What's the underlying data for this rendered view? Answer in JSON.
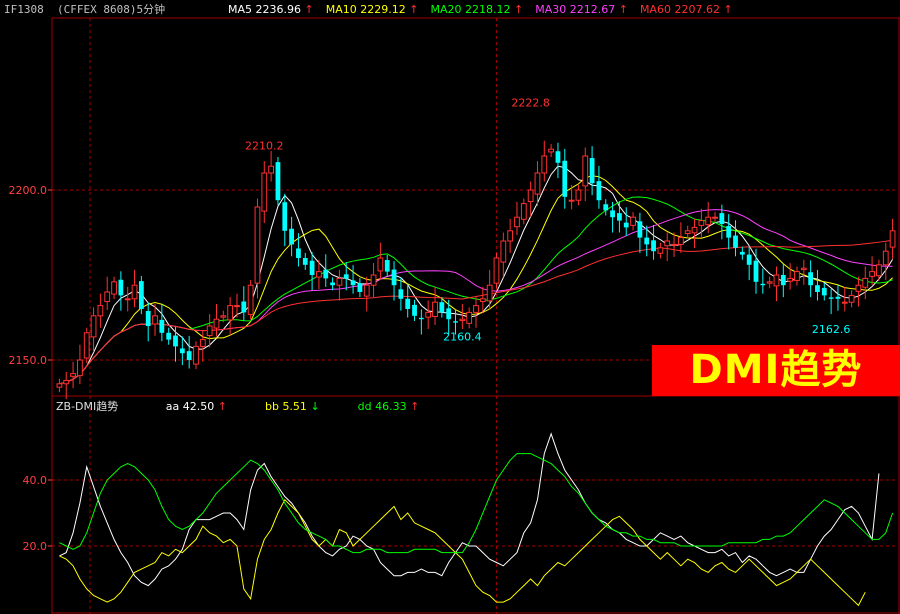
{
  "header": {
    "symbol": "IF1308",
    "exchange_period": "(CFFEX 8608)5分钟",
    "ma_labels": [
      {
        "label": "MA5",
        "value": "2236.96",
        "arrow": "↑",
        "color": "#ffffff"
      },
      {
        "label": "MA10",
        "value": "2229.12",
        "arrow": "↑",
        "color": "#ffff00"
      },
      {
        "label": "MA20",
        "value": "2218.12",
        "arrow": "↑",
        "color": "#00ff00"
      },
      {
        "label": "MA30",
        "value": "2212.67",
        "arrow": "↑",
        "color": "#ff40ff"
      },
      {
        "label": "MA60",
        "value": "2207.62",
        "arrow": "↑",
        "color": "#ff3030"
      }
    ]
  },
  "indicator_header": {
    "name": "ZB-DMI趋势",
    "items": [
      {
        "label": "aa",
        "value": "42.50",
        "arrow": "↑",
        "arrow_color": "#ff3030",
        "color": "#ffffff"
      },
      {
        "label": "bb",
        "value": "5.51",
        "arrow": "↓",
        "arrow_color": "#00ff00",
        "color": "#ffff00"
      },
      {
        "label": "dd",
        "value": "46.33",
        "arrow": "↑",
        "arrow_color": "#ff3030",
        "color": "#00ff00"
      }
    ]
  },
  "banner_text": "DMI趋势",
  "colors": {
    "up": "#ff3030",
    "down": "#00ffff",
    "grid": "#a00000",
    "axis_text": "#ff4040"
  },
  "chart_data": [
    {
      "type": "candlestick",
      "y_ticks": [
        "2200.0",
        "2150.0"
      ],
      "ylim": [
        2140,
        2250
      ],
      "annotations": [
        {
          "text": "2210.2",
          "index": 30,
          "value": 2210.2,
          "position": "above"
        },
        {
          "text": "2222.8",
          "index": 69,
          "value": 2222.8,
          "position": "above"
        },
        {
          "text": "2160.4",
          "index": 59,
          "value": 2160.4,
          "position": "below"
        },
        {
          "text": "2162.6",
          "index": 113,
          "value": 2162.6,
          "position": "below"
        }
      ],
      "series_colors": {
        "MA5": "#ffffff",
        "MA10": "#ffff00",
        "MA20": "#00ff00",
        "MA30": "#ff40ff",
        "MA60": "#ff3030"
      },
      "closes": [
        2143,
        2144,
        2146,
        2150,
        2158,
        2163,
        2166,
        2170,
        2173,
        2169,
        2168,
        2172,
        2165,
        2160,
        2163,
        2158,
        2156,
        2154,
        2152,
        2150,
        2154,
        2156,
        2160,
        2162,
        2163,
        2166,
        2166,
        2164,
        2172,
        2195,
        2205,
        2207,
        2197,
        2188,
        2184,
        2180,
        2178,
        2175,
        2176,
        2174,
        2172,
        2174,
        2174,
        2172,
        2170,
        2172,
        2175,
        2180,
        2176,
        2172,
        2168,
        2165,
        2163,
        2162,
        2164,
        2167,
        2164,
        2162,
        2161,
        2162,
        2164,
        2166,
        2168,
        2172,
        2180,
        2185,
        2188,
        2192,
        2196,
        2200,
        2205,
        2210,
        2212,
        2208,
        2198,
        2197,
        2200,
        2210,
        2202,
        2197,
        2194,
        2192,
        2191,
        2189,
        2192,
        2186,
        2184,
        2182,
        2183,
        2185,
        2184,
        2186,
        2188,
        2189,
        2191,
        2192,
        2192,
        2190,
        2186,
        2183,
        2181,
        2178,
        2173,
        2172,
        2173,
        2175,
        2172,
        2174,
        2176,
        2177,
        2172,
        2170,
        2169,
        2168,
        2168,
        2167,
        2169,
        2172,
        2174,
        2176,
        2178,
        2182,
        2188
      ],
      "indicator_ylim": [
        0,
        60
      ],
      "indicator_ticks": [
        "40.0",
        "20.0"
      ],
      "indicator_series": [
        {
          "name": "aa",
          "color": "#ffffff",
          "values": [
            17,
            18,
            24,
            33,
            44,
            38,
            32,
            27,
            22,
            18,
            15,
            11,
            9,
            8,
            10,
            13,
            14,
            16,
            19,
            25,
            28,
            28,
            28,
            29,
            30,
            30,
            28,
            25,
            37,
            43,
            45,
            41,
            38,
            35,
            33,
            30,
            27,
            23,
            20,
            18,
            17,
            19,
            20,
            23,
            22,
            20,
            19,
            15,
            13,
            11,
            11,
            12,
            12,
            13,
            12,
            12,
            11,
            15,
            18,
            21,
            20,
            20,
            18,
            16,
            15,
            14,
            16,
            18,
            24,
            27,
            34,
            48,
            54,
            48,
            43,
            40,
            37,
            33,
            30,
            28,
            27,
            25,
            24,
            22,
            21,
            20,
            20,
            22,
            24,
            23,
            22,
            23,
            21,
            20,
            19,
            18,
            18,
            19,
            17,
            18,
            15,
            17,
            16,
            14,
            12,
            11,
            12,
            13,
            12,
            12,
            16,
            20,
            23,
            25,
            28,
            31,
            32,
            30,
            26,
            22,
            42
          ]
        },
        {
          "name": "bb",
          "color": "#ffff00",
          "values": [
            17,
            16,
            14,
            10,
            7,
            5,
            4,
            3,
            4,
            6,
            9,
            12,
            13,
            14,
            15,
            18,
            17,
            19,
            18,
            20,
            22,
            26,
            24,
            23,
            21,
            22,
            20,
            7,
            4,
            16,
            22,
            25,
            30,
            34,
            32,
            30,
            26,
            22,
            20,
            22,
            20,
            25,
            24,
            20,
            22,
            24,
            26,
            28,
            30,
            32,
            28,
            30,
            27,
            26,
            25,
            24,
            22,
            20,
            18,
            16,
            12,
            8,
            6,
            5,
            3,
            3,
            4,
            6,
            8,
            10,
            8,
            11,
            13,
            15,
            14,
            16,
            18,
            20,
            22,
            24,
            26,
            28,
            29,
            27,
            25,
            22,
            20,
            18,
            16,
            18,
            16,
            14,
            16,
            15,
            13,
            12,
            14,
            15,
            13,
            12,
            14,
            16,
            14,
            12,
            10,
            8,
            9,
            10,
            12,
            14,
            16,
            14,
            12,
            10,
            8,
            6,
            4,
            2,
            6
          ]
        },
        {
          "name": "dd",
          "color": "#00ff00",
          "values": [
            21,
            20,
            19,
            20,
            24,
            30,
            36,
            40,
            42,
            44,
            45,
            44,
            42,
            40,
            37,
            32,
            28,
            26,
            25,
            26,
            28,
            30,
            33,
            36,
            38,
            40,
            42,
            44,
            46,
            45,
            43,
            40,
            37,
            33,
            30,
            27,
            25,
            24,
            23,
            22,
            20,
            20,
            19,
            18,
            18,
            19,
            19,
            19,
            18,
            18,
            18,
            18,
            19,
            19,
            19,
            19,
            18,
            18,
            18,
            18,
            21,
            25,
            30,
            35,
            40,
            43,
            46,
            48,
            48,
            48,
            47,
            46,
            45,
            43,
            41,
            38,
            36,
            33,
            30,
            28,
            26,
            25,
            24,
            24,
            23,
            23,
            22,
            22,
            21,
            21,
            21,
            20,
            20,
            20,
            20,
            20,
            20,
            20,
            21,
            21,
            21,
            21,
            21,
            22,
            22,
            23,
            23,
            24,
            26,
            28,
            30,
            32,
            34,
            33,
            32,
            30,
            28,
            26,
            24,
            22,
            22,
            24,
            30
          ]
        }
      ]
    }
  ]
}
